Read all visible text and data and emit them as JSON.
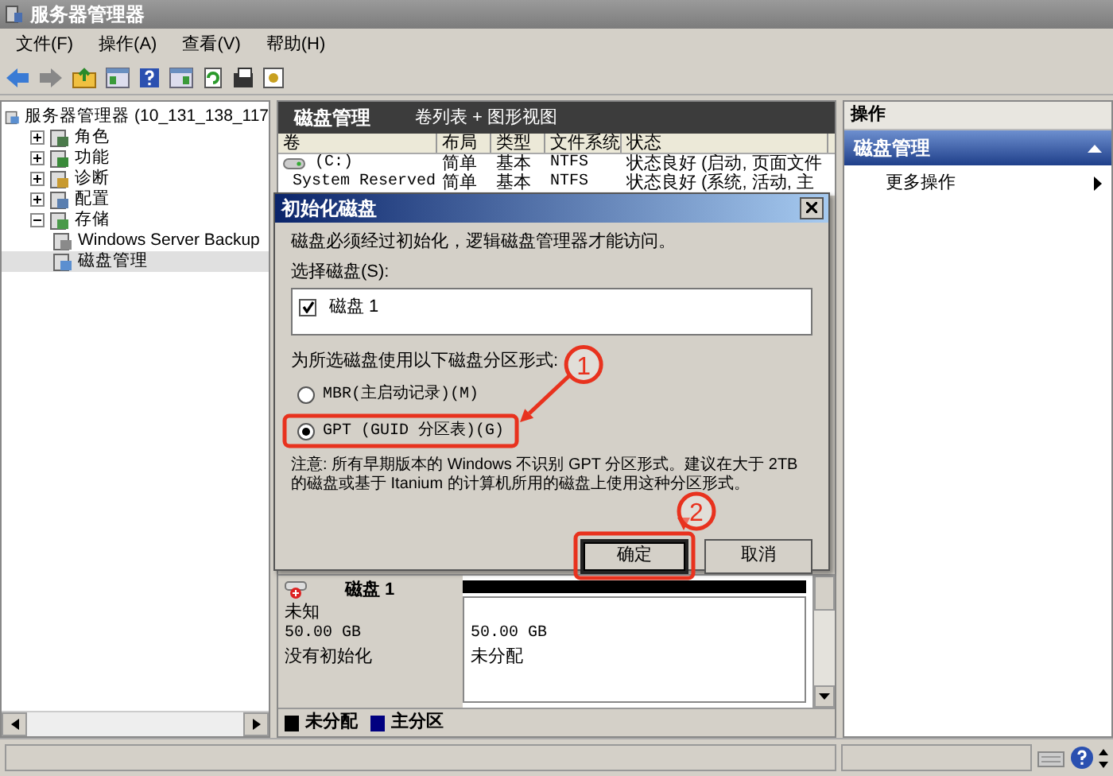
{
  "window": {
    "title": "服务器管理器"
  },
  "menu": [
    "文件(F)",
    "操作(A)",
    "查看(V)",
    "帮助(H)"
  ],
  "tree": {
    "label": "服务器管理器 (10_131_138_117",
    "selected": false,
    "children": [
      {
        "label": "角色",
        "expanded": false,
        "selected": false
      },
      {
        "label": "功能",
        "expanded": false,
        "selected": false
      },
      {
        "label": "诊断",
        "expanded": false,
        "selected": false
      },
      {
        "label": "配置",
        "expanded": false,
        "selected": false
      },
      {
        "label": "存储",
        "expanded": true,
        "selected": false,
        "children": [
          {
            "label": "Windows Server Backup",
            "selected": false
          },
          {
            "label": "磁盘管理",
            "selected": true
          }
        ]
      }
    ]
  },
  "center": {
    "title": "磁盘管理",
    "subtitle": "卷列表 + 图形视图",
    "columns": [
      "卷",
      "布局",
      "类型",
      "文件系统",
      "状态"
    ],
    "rows": [
      [
        "(C:)",
        "简单",
        "基本",
        "NTFS",
        "状态良好 (启动, 页面文件"
      ],
      [
        "System Reserved",
        "简单",
        "基本",
        "NTFS",
        "状态良好 (系统, 活动, 主"
      ]
    ],
    "disk": {
      "name": "磁盘 1",
      "type": "未知",
      "size": "50.00 GB",
      "status": "没有初始化",
      "partition_size": "50.00 GB",
      "partition_status": "未分配"
    },
    "legend": [
      {
        "label": "未分配",
        "color": "#000000"
      },
      {
        "label": "主分区",
        "color": "#000080"
      }
    ]
  },
  "actions": {
    "title": "操作",
    "section": "磁盘管理",
    "items": [
      "更多操作"
    ]
  },
  "dialog": {
    "title": "初始化磁盘",
    "message": "磁盘必须经过初始化，逻辑磁盘管理器才能访问。",
    "select_label": "选择磁盘(S):",
    "disks": [
      {
        "label": "磁盘 1",
        "checked": true
      }
    ],
    "style_label": "为所选磁盘使用以下磁盘分区形式:",
    "options": [
      {
        "label": "MBR(主启动记录)(M)",
        "selected": false
      },
      {
        "label": "GPT (GUID 分区表)(G)",
        "selected": true
      }
    ],
    "note": "注意: 所有早期版本的 Windows 不识别 GPT 分区形式。建议在大于 2TB 的磁盘或基于 Itanium 的计算机所用的磁盘上使用这种分区形式。",
    "buttons": [
      {
        "label": "确定",
        "default": true
      },
      {
        "label": "取消",
        "default": false
      }
    ]
  },
  "annotations": [
    {
      "number": "1"
    },
    {
      "number": "2"
    }
  ]
}
